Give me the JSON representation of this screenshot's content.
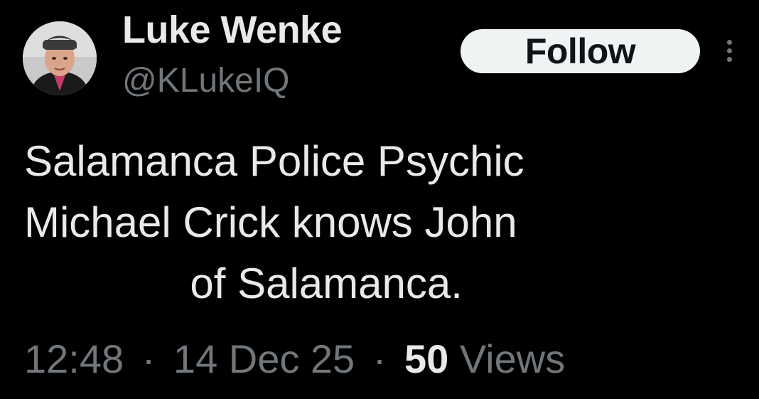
{
  "user": {
    "display_name": "Luke Wenke",
    "handle": "@KLukeIQ"
  },
  "follow_button": {
    "label": "Follow"
  },
  "tweet": {
    "text": "Salamanca Police Psychic\nMichael Crick knows John\n              of Salamanca."
  },
  "meta": {
    "time": "12:48",
    "separator": "·",
    "date": "14 Dec 25",
    "views_count": "50",
    "views_label": "Views"
  },
  "icons": {
    "more": "more-options-icon"
  },
  "colors": {
    "background": "#000000",
    "primary_text": "#e7e9ea",
    "secondary_text": "#71767b",
    "follow_button_bg": "#eff3f4",
    "follow_button_text": "#0f1419"
  }
}
